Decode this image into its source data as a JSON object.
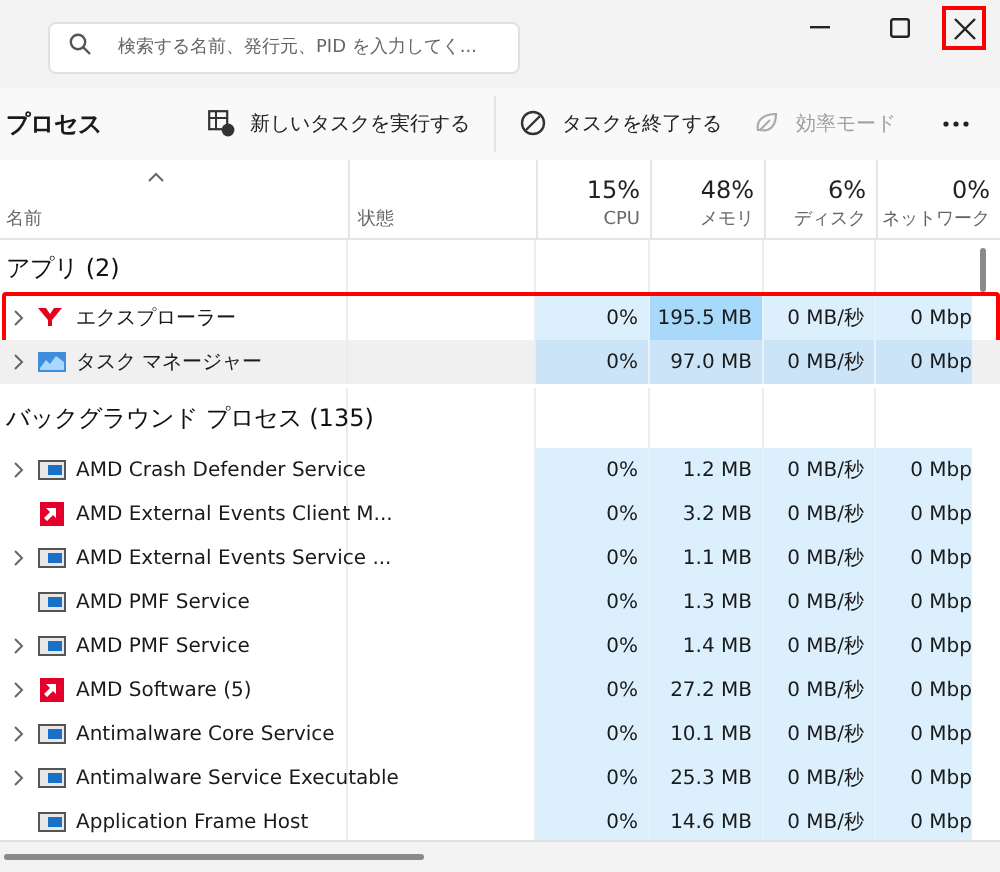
{
  "search": {
    "placeholder": "検索する名前、発行元、PID を入力してく..."
  },
  "window_controls": {
    "close_highlighted": true
  },
  "toolbar": {
    "title": "プロセス",
    "actions": [
      {
        "kind": "run",
        "label": "新しいタスクを実行する",
        "disabled": false
      },
      {
        "kind": "end",
        "label": "タスクを終了する",
        "disabled": false
      },
      {
        "kind": "eco",
        "label": "効率モード",
        "disabled": true
      }
    ]
  },
  "columns": [
    {
      "label": "名前",
      "sorted": true
    },
    {
      "label": "状態",
      "sorted": false
    },
    {
      "label": "CPU",
      "usage": "15%",
      "sorted": false
    },
    {
      "label": "メモリ",
      "usage": "48%",
      "sorted": false
    },
    {
      "label": "ディスク",
      "usage": "6%",
      "sorted": false
    },
    {
      "label": "ネットワーク",
      "usage": "0%",
      "sorted": false
    }
  ],
  "groups": [
    {
      "title": "アプリ (2)",
      "rows": [
        {
          "kind": "yahoo",
          "name": "エクスプローラー",
          "expandable": true,
          "highlighted": true,
          "hovered": false,
          "memory_high": true,
          "cpu": "0%",
          "memory": "195.5 MB",
          "disk": "0 MB/秒",
          "network": "0 Mbp"
        },
        {
          "kind": "taskmgr",
          "name": "タスク マネージャー",
          "expandable": true,
          "highlighted": false,
          "hovered": true,
          "memory_high": false,
          "cpu": "0%",
          "memory": "97.0 MB",
          "disk": "0 MB/秒",
          "network": "0 Mbp"
        }
      ]
    },
    {
      "title": "バックグラウンド プロセス (135)",
      "rows": [
        {
          "kind": "service",
          "name": "AMD Crash Defender Service",
          "expandable": true,
          "highlighted": false,
          "hovered": false,
          "memory_high": false,
          "cpu": "0%",
          "memory": "1.2 MB",
          "disk": "0 MB/秒",
          "network": "0 Mbp"
        },
        {
          "kind": "amd",
          "name": "AMD External Events Client M...",
          "expandable": false,
          "highlighted": false,
          "hovered": false,
          "memory_high": false,
          "cpu": "0%",
          "memory": "3.2 MB",
          "disk": "0 MB/秒",
          "network": "0 Mbp"
        },
        {
          "kind": "service",
          "name": "AMD External Events Service ...",
          "expandable": true,
          "highlighted": false,
          "hovered": false,
          "memory_high": false,
          "cpu": "0%",
          "memory": "1.1 MB",
          "disk": "0 MB/秒",
          "network": "0 Mbp"
        },
        {
          "kind": "service",
          "name": "AMD PMF Service",
          "expandable": false,
          "highlighted": false,
          "hovered": false,
          "memory_high": false,
          "cpu": "0%",
          "memory": "1.3 MB",
          "disk": "0 MB/秒",
          "network": "0 Mbp"
        },
        {
          "kind": "service",
          "name": "AMD PMF Service",
          "expandable": true,
          "highlighted": false,
          "hovered": false,
          "memory_high": false,
          "cpu": "0%",
          "memory": "1.4 MB",
          "disk": "0 MB/秒",
          "network": "0 Mbp"
        },
        {
          "kind": "amd",
          "name": "AMD Software (5)",
          "expandable": true,
          "highlighted": false,
          "hovered": false,
          "memory_high": false,
          "cpu": "0%",
          "memory": "27.2 MB",
          "disk": "0 MB/秒",
          "network": "0 Mbp"
        },
        {
          "kind": "service",
          "name": "Antimalware Core Service",
          "expandable": true,
          "highlighted": false,
          "hovered": false,
          "memory_high": false,
          "cpu": "0%",
          "memory": "10.1 MB",
          "disk": "0 MB/秒",
          "network": "0 Mbp"
        },
        {
          "kind": "service",
          "name": "Antimalware Service Executable",
          "expandable": true,
          "highlighted": false,
          "hovered": false,
          "memory_high": false,
          "cpu": "0%",
          "memory": "25.3 MB",
          "disk": "0 MB/秒",
          "network": "0 Mbp"
        },
        {
          "kind": "service",
          "name": "Application Frame Host",
          "expandable": false,
          "highlighted": false,
          "hovered": false,
          "memory_high": false,
          "cpu": "0%",
          "memory": "14.6 MB",
          "disk": "0 MB/秒",
          "network": "0 Mbp"
        }
      ]
    }
  ]
}
